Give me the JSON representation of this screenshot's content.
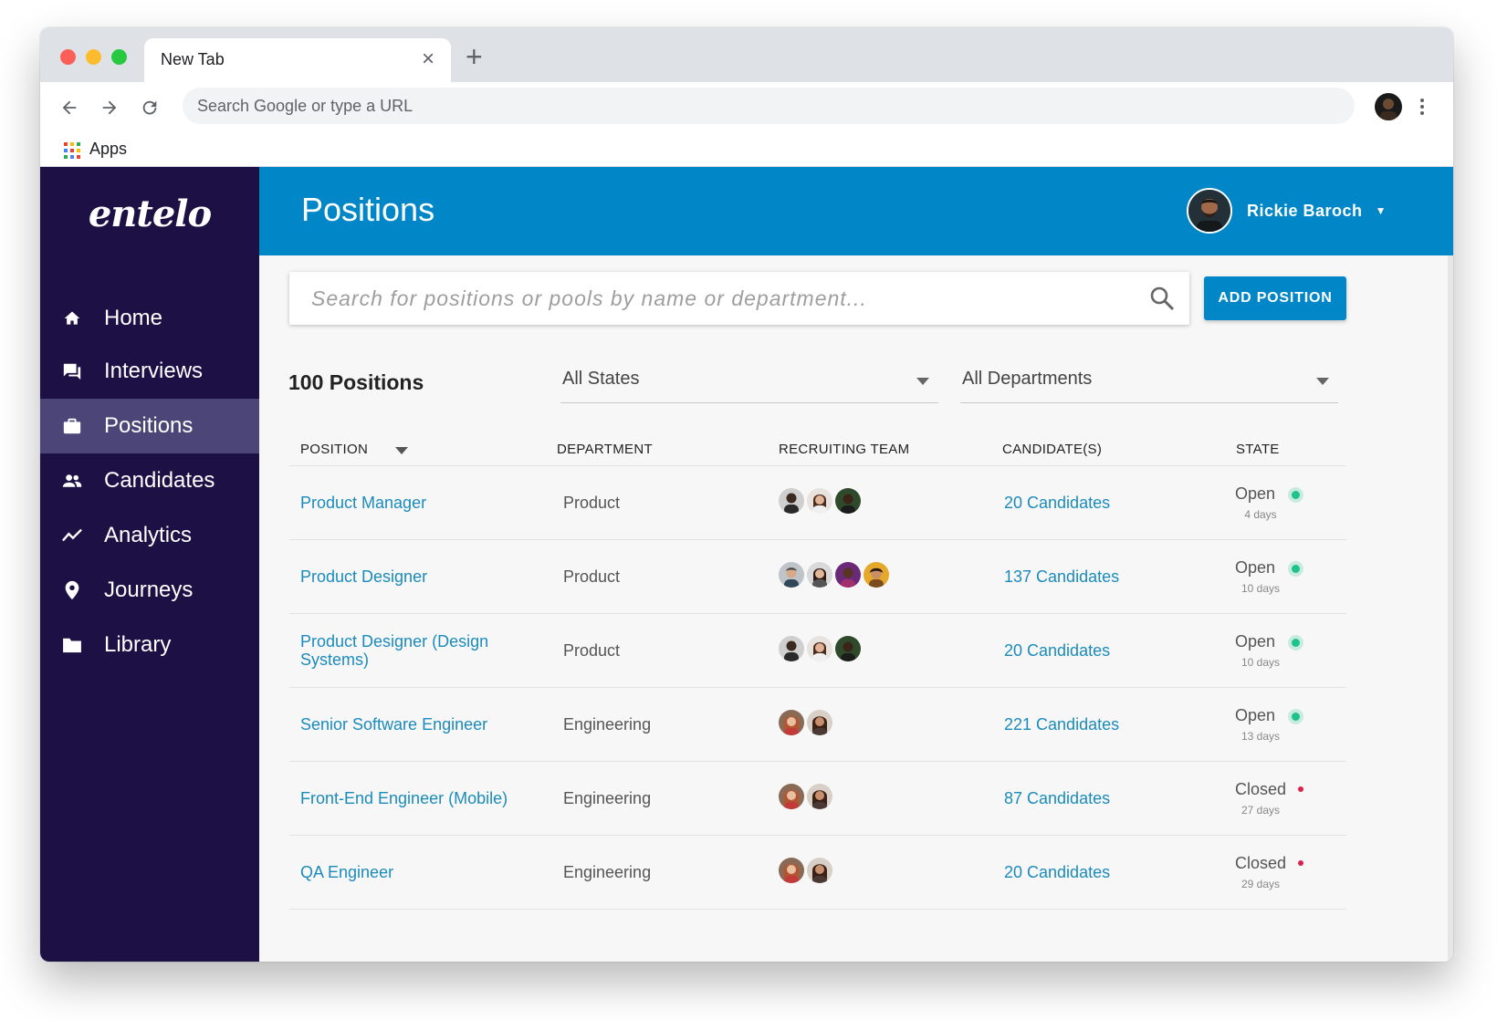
{
  "browser": {
    "tab_title": "New Tab",
    "tab_close": "×",
    "new_tab": "+",
    "omnibox_placeholder": "Search Google or type a URL",
    "bookmark_apps": "Apps"
  },
  "sidebar": {
    "logo": "entelo",
    "items": [
      {
        "label": "Home",
        "icon": "home-icon",
        "active": false
      },
      {
        "label": "Interviews",
        "icon": "chat-icon",
        "active": false
      },
      {
        "label": "Positions",
        "icon": "briefcase-icon",
        "active": true
      },
      {
        "label": "Candidates",
        "icon": "people-icon",
        "active": false
      },
      {
        "label": "Analytics",
        "icon": "trend-icon",
        "active": false
      },
      {
        "label": "Journeys",
        "icon": "location-pin-icon",
        "active": false
      },
      {
        "label": "Library",
        "icon": "folder-icon",
        "active": false
      }
    ]
  },
  "header": {
    "title": "Positions",
    "user_name": "Rickie Baroch"
  },
  "search": {
    "placeholder": "Search for positions or pools by name or department..."
  },
  "add_button": "ADD POSITION",
  "filters": {
    "count_label": "100 Positions",
    "states": "All States",
    "departments": "All Departments"
  },
  "table": {
    "columns": [
      "POSITION",
      "DEPARTMENT",
      "RECRUITING TEAM",
      "CANDIDATE(S)",
      "STATE"
    ],
    "rows": [
      {
        "position": "Product Manager",
        "department": "Product",
        "team_size": 3,
        "candidates": "20 Candidates",
        "state": "Open",
        "age": "4 days"
      },
      {
        "position": "Product Designer",
        "department": "Product",
        "team_size": 4,
        "candidates": "137 Candidates",
        "state": "Open",
        "age": "10 days"
      },
      {
        "position": "Product Designer (Design Systems)",
        "department": "Product",
        "team_size": 3,
        "candidates": "20 Candidates",
        "state": "Open",
        "age": "10 days"
      },
      {
        "position": "Senior Software Engineer",
        "department": "Engineering",
        "team_size": 2,
        "candidates": "221 Candidates",
        "state": "Open",
        "age": "13 days"
      },
      {
        "position": "Front-End Engineer (Mobile)",
        "department": "Engineering",
        "team_size": 2,
        "candidates": "87 Candidates",
        "state": "Closed",
        "age": "27 days"
      },
      {
        "position": "QA Engineer",
        "department": "Engineering",
        "team_size": 2,
        "candidates": "20 Candidates",
        "state": "Closed",
        "age": "29 days"
      }
    ]
  },
  "colors": {
    "sidebar": "#1c1044",
    "sidebar_active": "#4b4677",
    "header": "#0187c7",
    "link": "#1b8bbb",
    "open": "#1fc28a",
    "closed": "#d8234a"
  }
}
